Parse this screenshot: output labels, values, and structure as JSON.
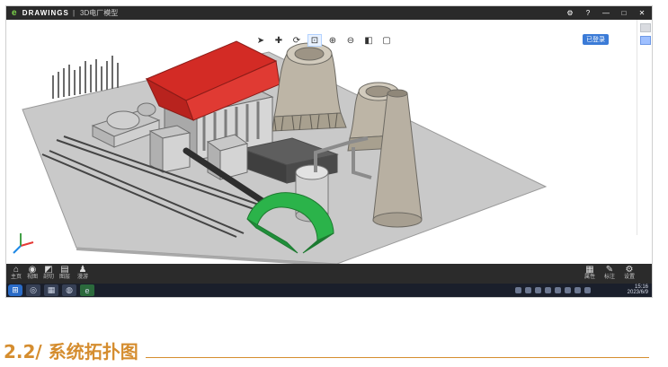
{
  "window": {
    "app_name": "DRAWINGS",
    "doc_title": "3D电厂模型",
    "controls": [
      "gear-icon",
      "help-icon",
      "minimize-icon",
      "maximize-icon",
      "close-icon"
    ],
    "tag_label": "已登录"
  },
  "toolbar": {
    "icons": [
      "select-icon",
      "pan-icon",
      "rotate-icon",
      "zoom-window-icon",
      "zoom-in-icon",
      "zoom-out-icon",
      "view-cube-icon",
      "frame-icon"
    ],
    "active_index": 3
  },
  "appbar": {
    "left_buttons": [
      {
        "icon": "home-icon",
        "label": "主页"
      },
      {
        "icon": "eye-icon",
        "label": "视图"
      },
      {
        "icon": "section-icon",
        "label": "剖切"
      },
      {
        "icon": "layers-icon",
        "label": "图层"
      },
      {
        "icon": "person-icon",
        "label": "漫游"
      }
    ],
    "right_buttons": [
      {
        "icon": "grid-icon",
        "label": "属性"
      },
      {
        "icon": "edit-icon",
        "label": "标注"
      },
      {
        "icon": "settings-icon",
        "label": "设置"
      }
    ]
  },
  "taskbar": {
    "clock_time": "15:16",
    "clock_date": "2023/6/9"
  },
  "document": {
    "caption": "2.2/ 系统拓扑图"
  },
  "colors": {
    "caption_orange": "#d58d2f",
    "boiler_red": "#d32b25",
    "duct_green": "#2bb34a",
    "ground_gray": "#c9c9c9",
    "tower_gray": "#bdb5a6"
  }
}
